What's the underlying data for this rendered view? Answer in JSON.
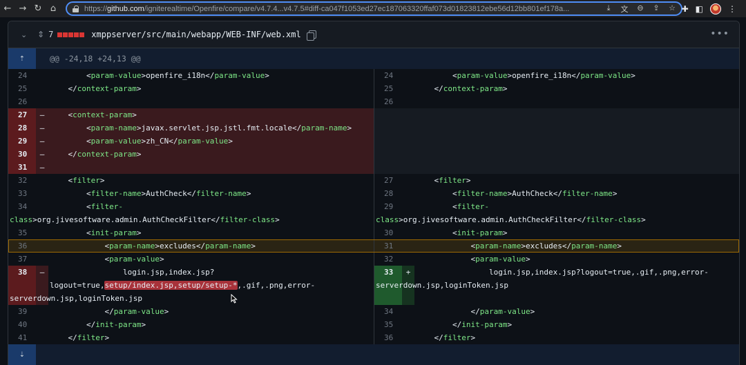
{
  "browser": {
    "url_prefix": "https://",
    "url_host": "github.com",
    "url_rest": "/igniterealtime/Openfire/compare/v4.7.4...v4.7.5#diff-ca047f1053ed27ec187063320ffaf073d01823812ebe56d12bb801ef178a...",
    "back": "←",
    "forward": "→",
    "reload": "↻",
    "home": "⌂"
  },
  "file": {
    "changes": "7",
    "path": "xmppserver/src/main/webapp/WEB-INF/web.xml",
    "menu": "•••"
  },
  "hunk": {
    "header": "@@ -24,18 +24,13 @@"
  },
  "lines": {
    "l24": {
      "n": "24",
      "code_a": "        <",
      "tag": "param-value",
      "code_b": ">openfire_i18n</",
      "tag2": "param-value",
      "code_c": ">"
    },
    "r24": {
      "n": "24"
    },
    "l25": {
      "n": "25",
      "code_a": "    </",
      "tag": "context-param",
      "code_b": ">"
    },
    "r25": {
      "n": "25"
    },
    "l26": {
      "n": "26"
    },
    "r26": {
      "n": "26"
    },
    "l27": {
      "n": "27",
      "sign": "–",
      "code_a": "    <",
      "tag": "context-param",
      "code_b": ">"
    },
    "l28": {
      "n": "28",
      "sign": "–",
      "code_a": "        <",
      "tag": "param-name",
      "code_b": ">javax.servlet.jsp.jstl.fmt.locale</",
      "tag2": "param-name",
      "code_c": ">"
    },
    "l29": {
      "n": "29",
      "sign": "–",
      "code_a": "        <",
      "tag": "param-value",
      "code_b": ">zh_CN</",
      "tag2": "param-value",
      "code_c": ">"
    },
    "l30": {
      "n": "30",
      "sign": "–",
      "code_a": "    </",
      "tag": "context-param",
      "code_b": ">"
    },
    "l31": {
      "n": "31",
      "sign": "–"
    },
    "l32": {
      "n": "32",
      "code_a": "    <",
      "tag": "filter",
      "code_b": ">"
    },
    "r27": {
      "n": "27"
    },
    "l33": {
      "n": "33",
      "code_a": "        <",
      "tag": "filter-name",
      "code_b": ">AuthCheck</",
      "tag2": "filter-name",
      "code_c": ">"
    },
    "r28": {
      "n": "28"
    },
    "l34": {
      "n": "34",
      "code_a": "        <",
      "tag": "filter-",
      "wrap_tag": "class",
      "code_b": ">org.jivesoftware.admin.AuthCheckFilter</",
      "tag2": "filter-class",
      "code_c": ">"
    },
    "r29": {
      "n": "29"
    },
    "l35": {
      "n": "35",
      "code_a": "        <",
      "tag": "init-param",
      "code_b": ">"
    },
    "r30": {
      "n": "30"
    },
    "l36": {
      "n": "36",
      "code_a": "            <",
      "tag": "param-name",
      "code_b": ">excludes</",
      "tag2": "param-name",
      "code_c": ">"
    },
    "r31": {
      "n": "31"
    },
    "l37": {
      "n": "37",
      "code_a": "            <",
      "tag": "param-value",
      "code_b": ">"
    },
    "r32": {
      "n": "32"
    },
    "l38": {
      "n": "38",
      "sign": "–",
      "line1": "                login.jsp,index.jsp?",
      "w_a": "logout=true,",
      "w_hl": "setup/index.jsp,setup/setup-*",
      "w_b": ",.gif,.png,error-",
      "line3": "serverdown.jsp,loginToken.jsp"
    },
    "r33": {
      "n": "33",
      "sign": "+",
      "line1": "                login.jsp,index.jsp?logout=true,.gif,.png,error-",
      "line2": "serverdown.jsp,loginToken.jsp"
    },
    "l39": {
      "n": "39",
      "code_a": "            </",
      "tag": "param-value",
      "code_b": ">"
    },
    "r34": {
      "n": "34"
    },
    "l40": {
      "n": "40",
      "code_a": "        </",
      "tag": "init-param",
      "code_b": ">"
    },
    "r35": {
      "n": "35"
    },
    "l41": {
      "n": "41",
      "code_a": "    </",
      "tag": "filter",
      "code_b": ">"
    },
    "r36": {
      "n": "36"
    }
  }
}
